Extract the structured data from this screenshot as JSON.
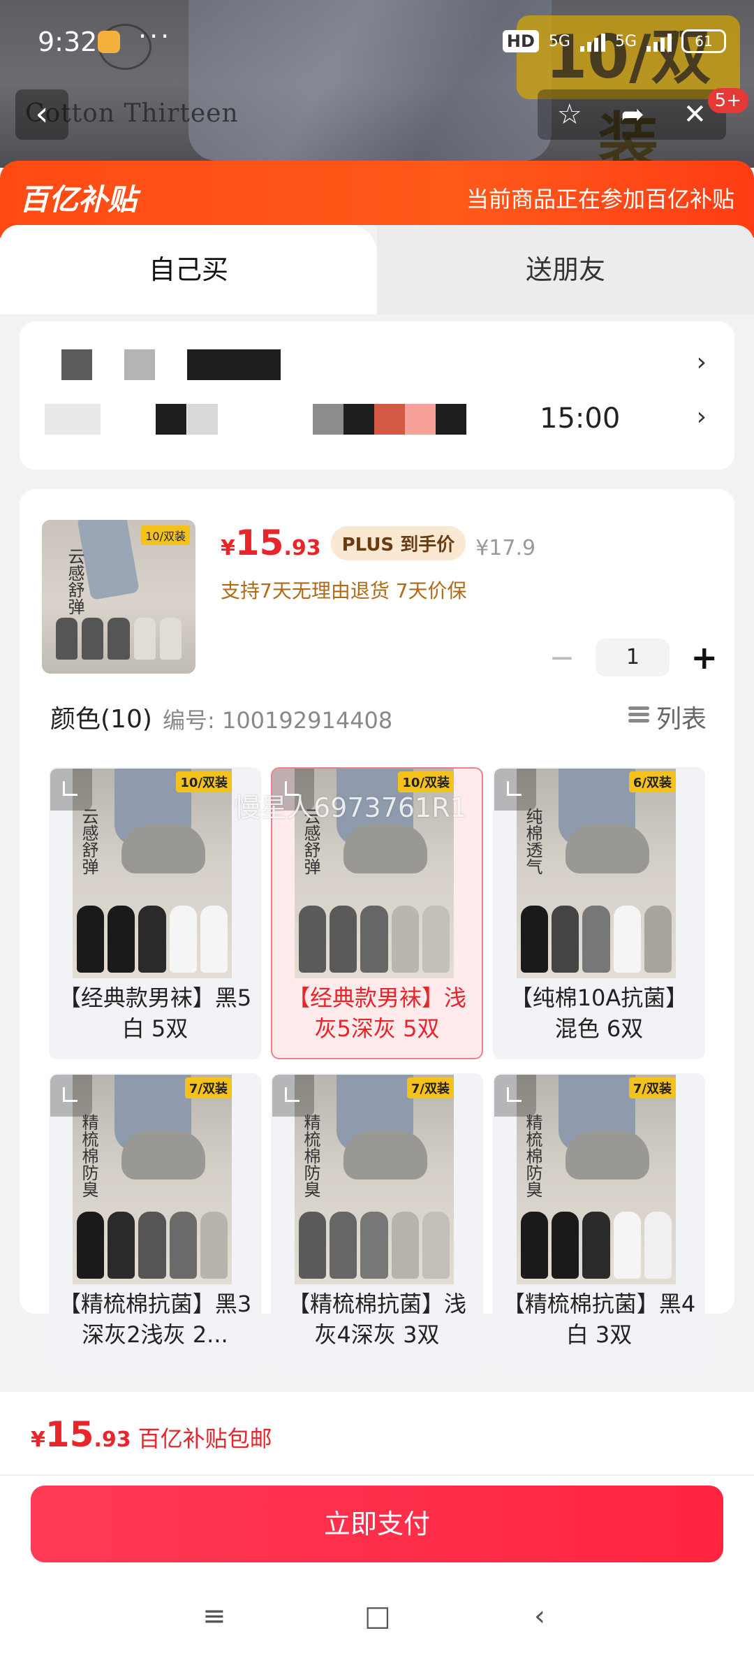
{
  "status_bar": {
    "time": "9:32",
    "more": "···",
    "hd_label": "HD",
    "net1": "5G",
    "net2": "5G",
    "battery": "61"
  },
  "hero": {
    "brand_name": "Cotton Thirteen",
    "pack_tag": "10/双装",
    "notif_count": "5+"
  },
  "subsidy_banner": {
    "logo": "百亿补贴",
    "message": "当前商品正在参加百亿补贴"
  },
  "tabs": [
    {
      "label": "自己买"
    },
    {
      "label": "送朋友"
    }
  ],
  "address": {
    "delivery_time": "15:00"
  },
  "product": {
    "price_currency": "¥",
    "price_int": "15",
    "price_dec": ".93",
    "plus_badge": "PLUS 到手价",
    "original_price": "¥17.9",
    "policy": "支持7天无理由退货  7天价保",
    "quantity": "1",
    "thumb_tag": "10/双装",
    "thumb_text": "云感舒弹"
  },
  "colors": {
    "heading": "颜色(10)",
    "code": "编号: 100192914408",
    "list_label": "列表",
    "options": [
      {
        "label": "【经典款男袜】黑5白 5双",
        "tag": "10/双装",
        "vtext": "云感舒弹",
        "selected": false
      },
      {
        "label": "【经典款男袜】浅灰5深灰 5双",
        "tag": "10/双装",
        "vtext": "云感舒弹",
        "selected": true
      },
      {
        "label": "【纯棉10A抗菌】混色 6双",
        "tag": "6/双装",
        "vtext": "纯棉透气",
        "selected": false
      },
      {
        "label": "【精梳棉抗菌】黑3深灰2浅灰 2...",
        "tag": "7/双装",
        "vtext": "精梳棉防臭",
        "selected": false
      },
      {
        "label": "【精梳棉抗菌】浅灰4深灰 3双",
        "tag": "7/双装",
        "vtext": "精梳棉防臭",
        "selected": false
      },
      {
        "label": "【精梳棉抗菌】黑4白 3双",
        "tag": "7/双装",
        "vtext": "精梳棉防臭",
        "selected": false
      }
    ]
  },
  "watermark": "慢星人6973761R1",
  "checkout": {
    "price_currency": "¥",
    "price_int": "15",
    "price_dec": ".93",
    "note": "百亿补贴包邮",
    "pay_label": "立即支付"
  },
  "system_nav": {
    "menu": "≡",
    "home": "□",
    "back": "‹"
  }
}
